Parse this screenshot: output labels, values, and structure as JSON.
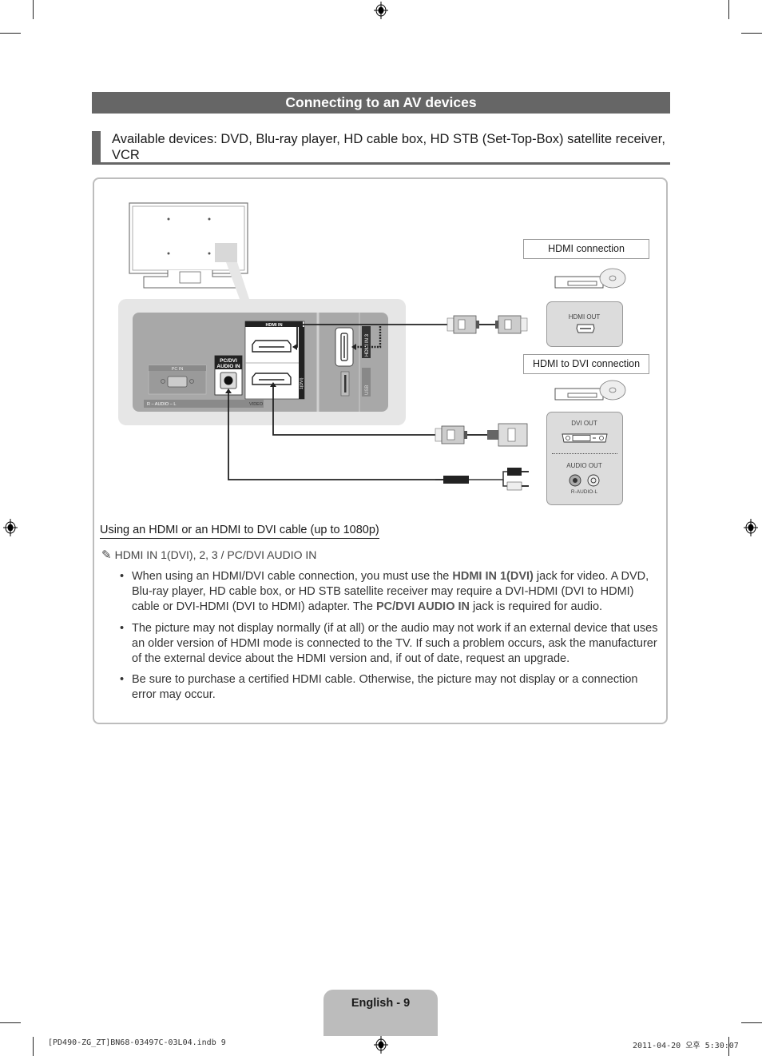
{
  "page": {
    "title": "Connecting to an AV devices",
    "subheading": "Available devices: DVD, Blu-ray player, HD cable box, HD STB (Set-Top-Box) satellite receiver, VCR",
    "colors": {
      "header_bar": "#666666",
      "page_tab": "#bcbcbc",
      "panel_border": "#bdbdbd"
    }
  },
  "diagram": {
    "tv_labels": {
      "hdmi_in": "HDMI IN",
      "hdmi_1_dvi": "1(DVI)",
      "hdmi_in_3": "HDMI IN 3",
      "usb": "USB",
      "pc_in": "PC IN",
      "pc_dvi_audio_in_line1": "PC/DVI",
      "pc_dvi_audio_in_line2": "AUDIO IN",
      "audio_strip": "R – AUDIO – L",
      "video_strip": "VIDEO"
    },
    "hdmi_connection_label": "HDMI connection",
    "hdmi_to_dvi_label": "HDMI to DVI connection",
    "hdmi_out_label": "HDMI OUT",
    "dvi_out_label": "DVI OUT",
    "audio_out_label": "AUDIO OUT",
    "audio_channels_label": "R-AUDIO-L"
  },
  "content": {
    "section_title": "Using an HDMI or an HDMI to DVI cable (up to 1080p)",
    "note_icon": "pencil-icon",
    "note": "HDMI IN 1(DVI), 2, 3 / PC/DVI AUDIO IN",
    "bullets": [
      {
        "p1": "When using an HDMI/DVI cable connection, you must use the ",
        "b1": "HDMI IN 1(DVI)",
        "p2": " jack for video. A DVD, Blu-ray player, HD cable box, or HD STB satellite receiver may require a DVI-HDMI (DVI to HDMI) cable or DVI-HDMI (DVI to HDMI) adapter. The ",
        "b2": "PC/DVI AUDIO IN",
        "p3": " jack is required for audio."
      },
      {
        "text": "The picture may not display normally (if at all) or the audio may not work if an external device that uses an older version of HDMI mode is connected to the TV. If such a problem occurs, ask the manufacturer of the external device about the HDMI version and, if out of date, request an upgrade."
      },
      {
        "text": "Be sure to purchase a certified HDMI cable. Otherwise, the picture may not display or a connection error may occur."
      }
    ]
  },
  "footer": {
    "page_label": "English - 9",
    "file_info": "[PD490-ZG_ZT]BN68-03497C-03L04.indb   9",
    "timestamp": "2011-04-20   오후 5:30:07"
  }
}
